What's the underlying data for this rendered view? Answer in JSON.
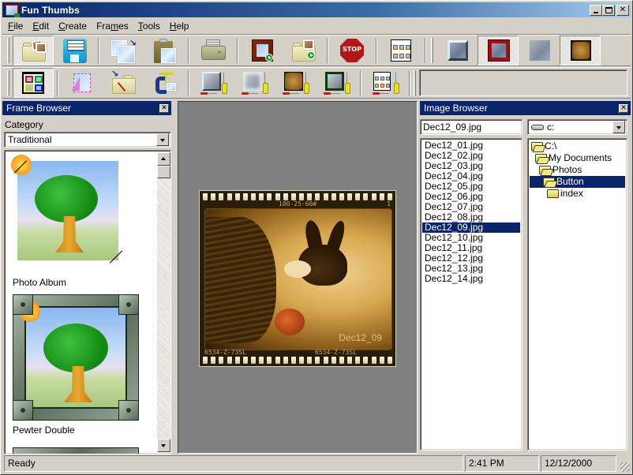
{
  "window": {
    "title": "Fun Thumbs",
    "controls": {
      "minimize": "_",
      "maximize": "□",
      "close": "✕"
    }
  },
  "menu": [
    {
      "label": "File",
      "accel": "F",
      "rest": "ile"
    },
    {
      "label": "Edit",
      "accel": "E",
      "rest": "dit"
    },
    {
      "label": "Create",
      "accel": "C",
      "rest": "reate"
    },
    {
      "label": "Frames",
      "pre": "Fra",
      "accel": "m",
      "rest": "es"
    },
    {
      "label": "Tools",
      "accel": "T",
      "rest": "ools"
    },
    {
      "label": "Help",
      "accel": "H",
      "rest": "elp"
    }
  ],
  "toolbar_row1": [
    {
      "name": "open-photos",
      "icon": "folder-photos-icon",
      "pressed": true
    },
    {
      "name": "save",
      "icon": "floppy-disk-icon"
    },
    {
      "name": "copy-image",
      "icon": "copy-images-icon"
    },
    {
      "name": "paste-image",
      "icon": "clipboard-paste-icon"
    },
    {
      "name": "print",
      "icon": "printer-icon"
    },
    {
      "name": "frame-slideshow",
      "icon": "wood-frame-play-icon"
    },
    {
      "name": "folder-slideshow",
      "icon": "folder-play-icon"
    },
    {
      "name": "stop",
      "icon": "stop-sign-icon",
      "text": "STOP"
    },
    {
      "name": "contact-sheet",
      "icon": "contact-sheet-icon"
    },
    {
      "name": "style-bevel",
      "icon": "bevel-frame-icon"
    },
    {
      "name": "style-red-frame",
      "icon": "red-frame-icon",
      "pressed": true
    },
    {
      "name": "style-soft-edge",
      "icon": "soft-edge-icon"
    },
    {
      "name": "style-sepia",
      "icon": "sepia-frame-icon",
      "pressed": true
    }
  ],
  "toolbar_row2": [
    {
      "name": "layout-grid",
      "icon": "layout-grid-icon",
      "pressed": true
    },
    {
      "name": "stretch-image",
      "icon": "stretch-image-icon"
    },
    {
      "name": "folder-edit",
      "icon": "folder-edit-icon"
    },
    {
      "name": "clamp",
      "icon": "clamp-icon"
    },
    {
      "name": "adjust-bevel",
      "icon": "bevel-adjust-icon"
    },
    {
      "name": "adjust-soft",
      "icon": "soft-adjust-icon"
    },
    {
      "name": "adjust-sepia",
      "icon": "sepia-adjust-icon"
    },
    {
      "name": "adjust-green-frame",
      "icon": "green-frame-adjust-icon"
    },
    {
      "name": "adjust-contact-sheet",
      "icon": "contact-sheet-adjust-icon"
    }
  ],
  "frame_browser": {
    "title": "Frame Browser",
    "category_label": "Category",
    "category_value": "Traditional",
    "frames": [
      {
        "label": "Photo Album"
      },
      {
        "label": "Pewter Double"
      }
    ],
    "scroll_position": 0.0
  },
  "workspace": {
    "film_top_code": "100-25-60#",
    "film_frame_number": "1",
    "film_bottom_code_left": "6534-Z-73SL",
    "film_bottom_code_right": "6534-Z-73SL",
    "photo_date_stamp": "Dec12_09"
  },
  "image_browser": {
    "title": "Image Browser",
    "filename": "Dec12_09.jpg",
    "drive": "c:",
    "files": [
      "Dec12_01.jpg",
      "Dec12_02.jpg",
      "Dec12_03.jpg",
      "Dec12_04.jpg",
      "Dec12_05.jpg",
      "Dec12_06.jpg",
      "Dec12_07.jpg",
      "Dec12_08.jpg",
      "Dec12_09.jpg",
      "Dec12_10.jpg",
      "Dec12_11.jpg",
      "Dec12_12.jpg",
      "Dec12_13.jpg",
      "Dec12_14.jpg"
    ],
    "selected_file": "Dec12_09.jpg",
    "folders": [
      {
        "label": "C:\\",
        "level": 0,
        "open": true
      },
      {
        "label": "My Documents",
        "level": 1,
        "open": true
      },
      {
        "label": "Photos",
        "level": 2,
        "open": true
      },
      {
        "label": "Button",
        "level": 3,
        "open": true,
        "selected": true
      },
      {
        "label": "index",
        "level": 4,
        "open": false
      }
    ]
  },
  "status": {
    "message": "Ready",
    "time": "2:41 PM",
    "date": "12/12/2000"
  },
  "colors": {
    "selection": "#0a246a",
    "face": "#d4d0c8",
    "workspace": "#808080"
  }
}
